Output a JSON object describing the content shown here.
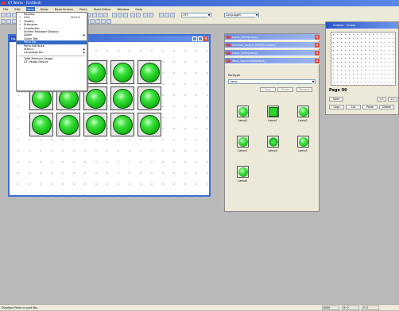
{
  "app": {
    "title": "GT Works - [Untitled]"
  },
  "menubar": [
    "File",
    "Edit",
    "View",
    "Draw",
    "Base Screen",
    "Parts",
    "Start Editor",
    "Window",
    "Help"
  ],
  "menubar_active": 2,
  "toolbar": {
    "combo1": "OFF",
    "combo2": "Language0"
  },
  "view_menu": {
    "items": [
      {
        "label": "Redraw",
        "shortcut": "",
        "check": false,
        "sub": false,
        "sep_after": false,
        "hl": false
      },
      {
        "label": "Grid",
        "shortcut": "Ctrl+G",
        "check": true,
        "sub": false,
        "sep_after": false,
        "hl": false
      },
      {
        "label": "Toolbar",
        "shortcut": "",
        "check": true,
        "sub": false,
        "sep_after": false,
        "hl": false
      },
      {
        "label": "Statusbar",
        "shortcut": "",
        "check": true,
        "sub": false,
        "sep_after": false,
        "hl": false
      },
      {
        "label": "Graphicbar",
        "shortcut": "",
        "check": true,
        "sub": false,
        "sep_after": false,
        "hl": false
      },
      {
        "label": "Screen Manager Display",
        "shortcut": "",
        "check": false,
        "sub": false,
        "sep_after": false,
        "hl": false
      },
      {
        "label": "Zoom",
        "shortcut": "",
        "check": false,
        "sub": true,
        "sep_after": false,
        "hl": false
      },
      {
        "label": "Zoom Rec",
        "shortcut": "",
        "check": false,
        "sub": false,
        "sep_after": false,
        "hl": false
      },
      {
        "label": "Parts No.",
        "shortcut": "",
        "check": false,
        "sub": false,
        "sep_after": false,
        "hl": true
      },
      {
        "label": "Parts Attribute",
        "shortcut": "",
        "check": false,
        "sub": false,
        "sep_after": false,
        "hl": false
      },
      {
        "label": "Status",
        "shortcut": "",
        "check": false,
        "sub": true,
        "sep_after": false,
        "hl": false
      },
      {
        "label": "Language No.",
        "shortcut": "",
        "check": false,
        "sub": true,
        "sep_after": true,
        "hl": false
      },
      {
        "label": "Total Memory Usage",
        "shortcut": "",
        "check": false,
        "sub": false,
        "sep_after": false,
        "hl": false
      },
      {
        "label": "GT Usage Device",
        "shortcut": "",
        "check": false,
        "sub": false,
        "sep_after": false,
        "hl": false
      }
    ]
  },
  "screen_window": {
    "caption": "No. 0 Screen"
  },
  "windows_list": [
    "Lamp_0000[Lamp]",
    "Function_switch_0000[Function]",
    "Lamp_0000[Lamp]",
    "Word_Switch0000[Word]"
  ],
  "palette": {
    "label": "Parttype",
    "selected": "Lamp",
    "buttons": [
      "Copy",
      "Delete",
      "Rename"
    ],
    "items": [
      {
        "label": "Lamp0",
        "shape": "circle"
      },
      {
        "label": "Lamp1",
        "shape": "square"
      },
      {
        "label": "Lamp2",
        "shape": "circle"
      },
      {
        "label": "Lamp3",
        "shape": "circle"
      },
      {
        "label": "Lamp4",
        "shape": "ring"
      },
      {
        "label": "Lamp5",
        "shape": "circle"
      },
      {
        "label": "Lamp6",
        "shape": "circle"
      }
    ]
  },
  "page_view": {
    "caption": "Untitled - Screen",
    "page_label": "Page 00",
    "buttons_row1": [
      "Open",
      "<<",
      ">>"
    ],
    "buttons_row2": [
      "Copy",
      "Cut",
      "Paste",
      "Delete"
    ]
  },
  "statusbar": {
    "text": "Displays Parts or part No.",
    "seg1": "NUM",
    "seg2": "X: 0",
    "seg3": "Y: 0"
  }
}
